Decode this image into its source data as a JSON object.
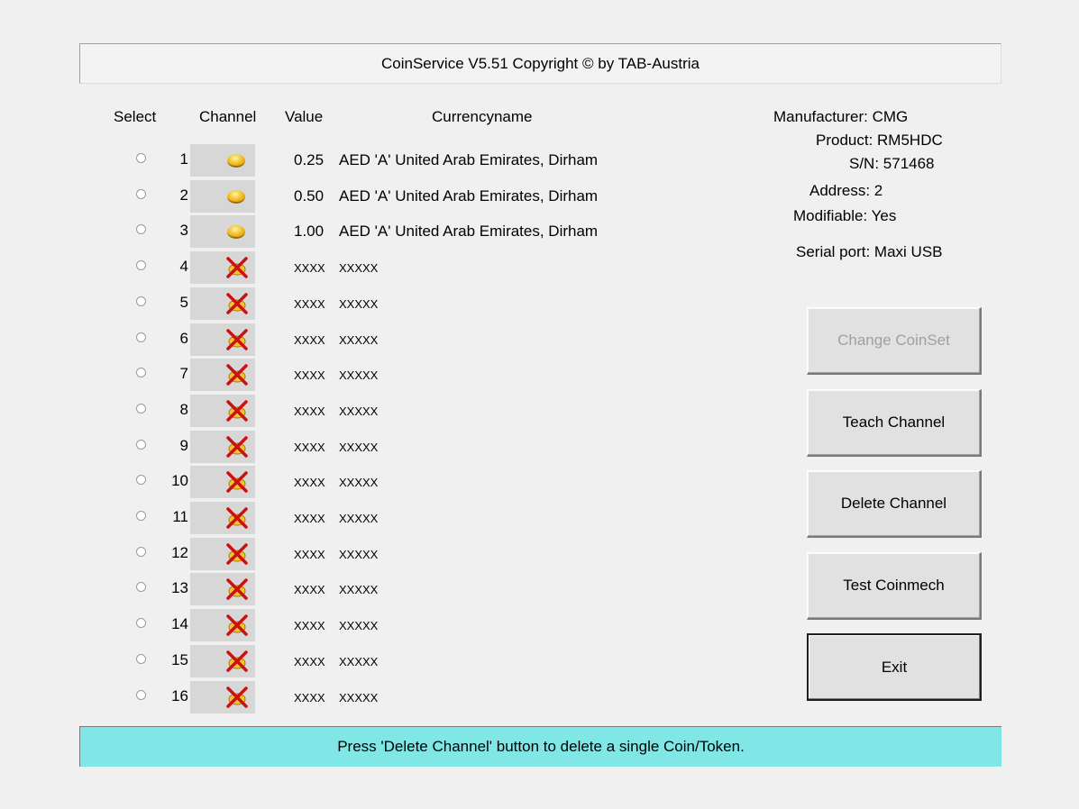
{
  "header": {
    "title": "CoinService V5.51 Copyright © by TAB-Austria"
  },
  "columns": {
    "select": "Select",
    "channel": "Channel",
    "value": "Value",
    "currencyname": "Currencyname"
  },
  "channels": [
    {
      "num": "1",
      "icon": "coin-icon",
      "value": "0.25",
      "currency": "AED 'A' United Arab Emirates, Dirham"
    },
    {
      "num": "2",
      "icon": "coin-icon",
      "value": "0.50",
      "currency": "AED 'A' United Arab Emirates, Dirham"
    },
    {
      "num": "3",
      "icon": "coin-icon",
      "value": "1.00",
      "currency": "AED 'A' United Arab Emirates, Dirham"
    },
    {
      "num": "4",
      "icon": "cross-icon",
      "value": "XXXX",
      "currency": "XXXXX"
    },
    {
      "num": "5",
      "icon": "cross-icon",
      "value": "XXXX",
      "currency": "XXXXX"
    },
    {
      "num": "6",
      "icon": "cross-icon",
      "value": "XXXX",
      "currency": "XXXXX"
    },
    {
      "num": "7",
      "icon": "cross-icon",
      "value": "XXXX",
      "currency": "XXXXX"
    },
    {
      "num": "8",
      "icon": "cross-icon",
      "value": "XXXX",
      "currency": "XXXXX"
    },
    {
      "num": "9",
      "icon": "cross-icon",
      "value": "XXXX",
      "currency": "XXXXX"
    },
    {
      "num": "10",
      "icon": "cross-icon",
      "value": "XXXX",
      "currency": "XXXXX"
    },
    {
      "num": "11",
      "icon": "cross-icon",
      "value": "XXXX",
      "currency": "XXXXX"
    },
    {
      "num": "12",
      "icon": "cross-icon",
      "value": "XXXX",
      "currency": "XXXXX"
    },
    {
      "num": "13",
      "icon": "cross-icon",
      "value": "XXXX",
      "currency": "XXXXX"
    },
    {
      "num": "14",
      "icon": "cross-icon",
      "value": "XXXX",
      "currency": "XXXXX"
    },
    {
      "num": "15",
      "icon": "cross-icon",
      "value": "XXXX",
      "currency": "XXXXX"
    },
    {
      "num": "16",
      "icon": "cross-icon",
      "value": "XXXX",
      "currency": "XXXXX"
    }
  ],
  "info": {
    "manufacturer": "Manufacturer: CMG",
    "product": "Product: RM5HDC",
    "serial_number": "S/N: 571468",
    "address": "Address: 2",
    "modifiable": "Modifiable: Yes",
    "serial_port": "Serial port: Maxi USB"
  },
  "buttons": {
    "change_coinset": "Change CoinSet",
    "teach_channel": "Teach Channel",
    "delete_channel": "Delete Channel",
    "test_coinmech": "Test Coinmech",
    "exit": "Exit"
  },
  "status": {
    "text": "Press 'Delete Channel' button to delete a single Coin/Token."
  },
  "colors": {
    "status_bg": "#80e6e6",
    "channel_cell_bg": "#d7d7d7",
    "coin_gold": "#f4c430",
    "cross_red": "#cc1010"
  }
}
